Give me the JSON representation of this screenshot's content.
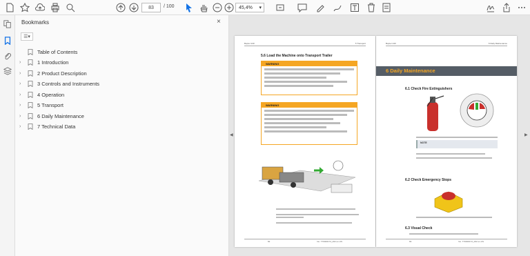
{
  "toolbar": {
    "current_page": "83",
    "total_pages": "/ 100",
    "zoom": "45,4%"
  },
  "panel": {
    "title": "Bookmarks",
    "close_glyph": "×",
    "options_glyph": "☰▾"
  },
  "bookmarks": [
    {
      "label": "Table of Contents",
      "expandable": false
    },
    {
      "label": "1 Introduction",
      "expandable": true
    },
    {
      "label": "2 Product Description",
      "expandable": true
    },
    {
      "label": "3 Controls and Instruments",
      "expandable": true
    },
    {
      "label": "4 Operation",
      "expandable": true
    },
    {
      "label": "5 Transport",
      "expandable": true
    },
    {
      "label": "6 Daily Maintenance",
      "expandable": true
    },
    {
      "label": "7 Technical Data",
      "expandable": true
    }
  ],
  "left_page": {
    "header_left": "Bopter 240",
    "header_right": "5 Transport",
    "section": "5.6   Load the Machine onto Transport Trailer",
    "warning1_title": "WARNING",
    "warning2_title": "WARNING",
    "footer_page": "82",
    "footer_doc": "No. TT0000172_002 en-US"
  },
  "right_page": {
    "header_left": "Bopter 240",
    "header_right": "6 Daily Maintenance",
    "chapter": "6  Daily Maintenance",
    "s1": "6.1   Check Fire Extinguishers",
    "s2": "6.2   Check Emergency Stops",
    "s3": "6.3   Visual Check",
    "note_label": "NOTE",
    "footer_page": "83",
    "footer_doc": "No. TT0000172_002 en-US"
  },
  "colors": {
    "accent": "#1473e6",
    "warning": "#f5a623",
    "chapter_bar": "#555d66"
  }
}
